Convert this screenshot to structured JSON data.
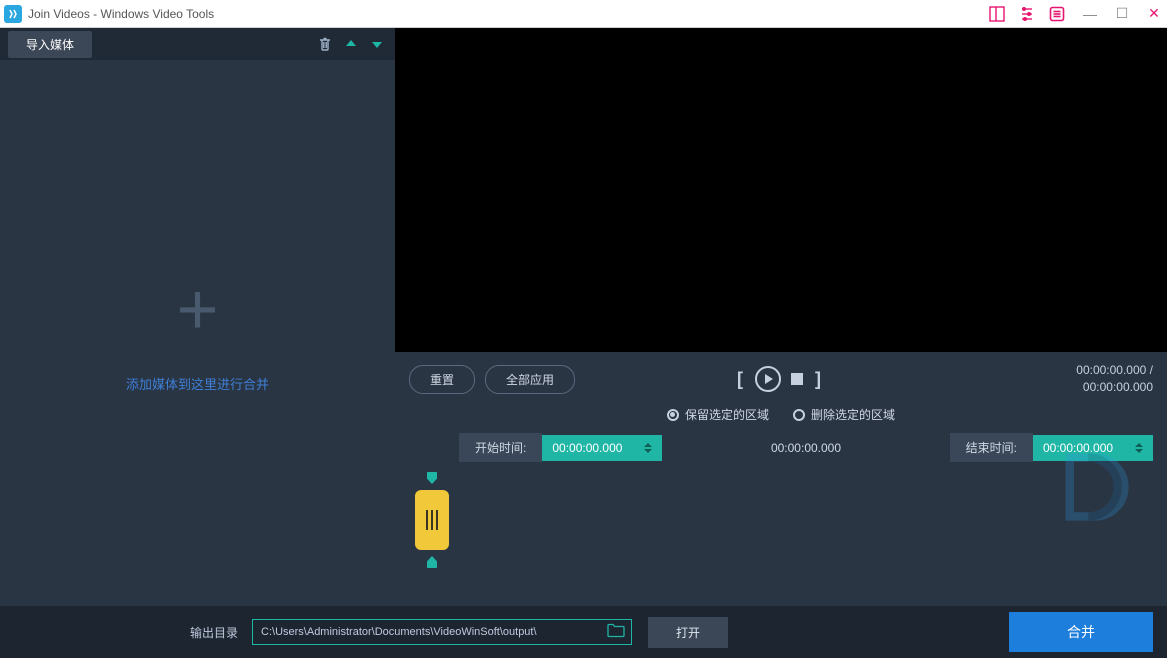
{
  "window": {
    "title": "Join Videos - Windows Video Tools"
  },
  "leftPanel": {
    "import_label": "导入媒体",
    "drop_hint": "添加媒体到这里进行合并"
  },
  "playback": {
    "reset_label": "重置",
    "apply_all_label": "全部应用",
    "time_current": "00:00:00.000 /",
    "time_total": "00:00:00.000"
  },
  "region": {
    "keep_label": "保留选定的区域",
    "delete_label": "删除选定的区域"
  },
  "range": {
    "start_label": "开始时间:",
    "start_value": "00:00:00.000",
    "mid_value": "00:00:00.000",
    "end_label": "结束时间:",
    "end_value": "00:00:00.000"
  },
  "footer": {
    "output_label": "输出目录",
    "output_path": "C:\\Users\\Administrator\\Documents\\VideoWinSoft\\output\\",
    "open_label": "打开",
    "merge_label": "合并"
  }
}
